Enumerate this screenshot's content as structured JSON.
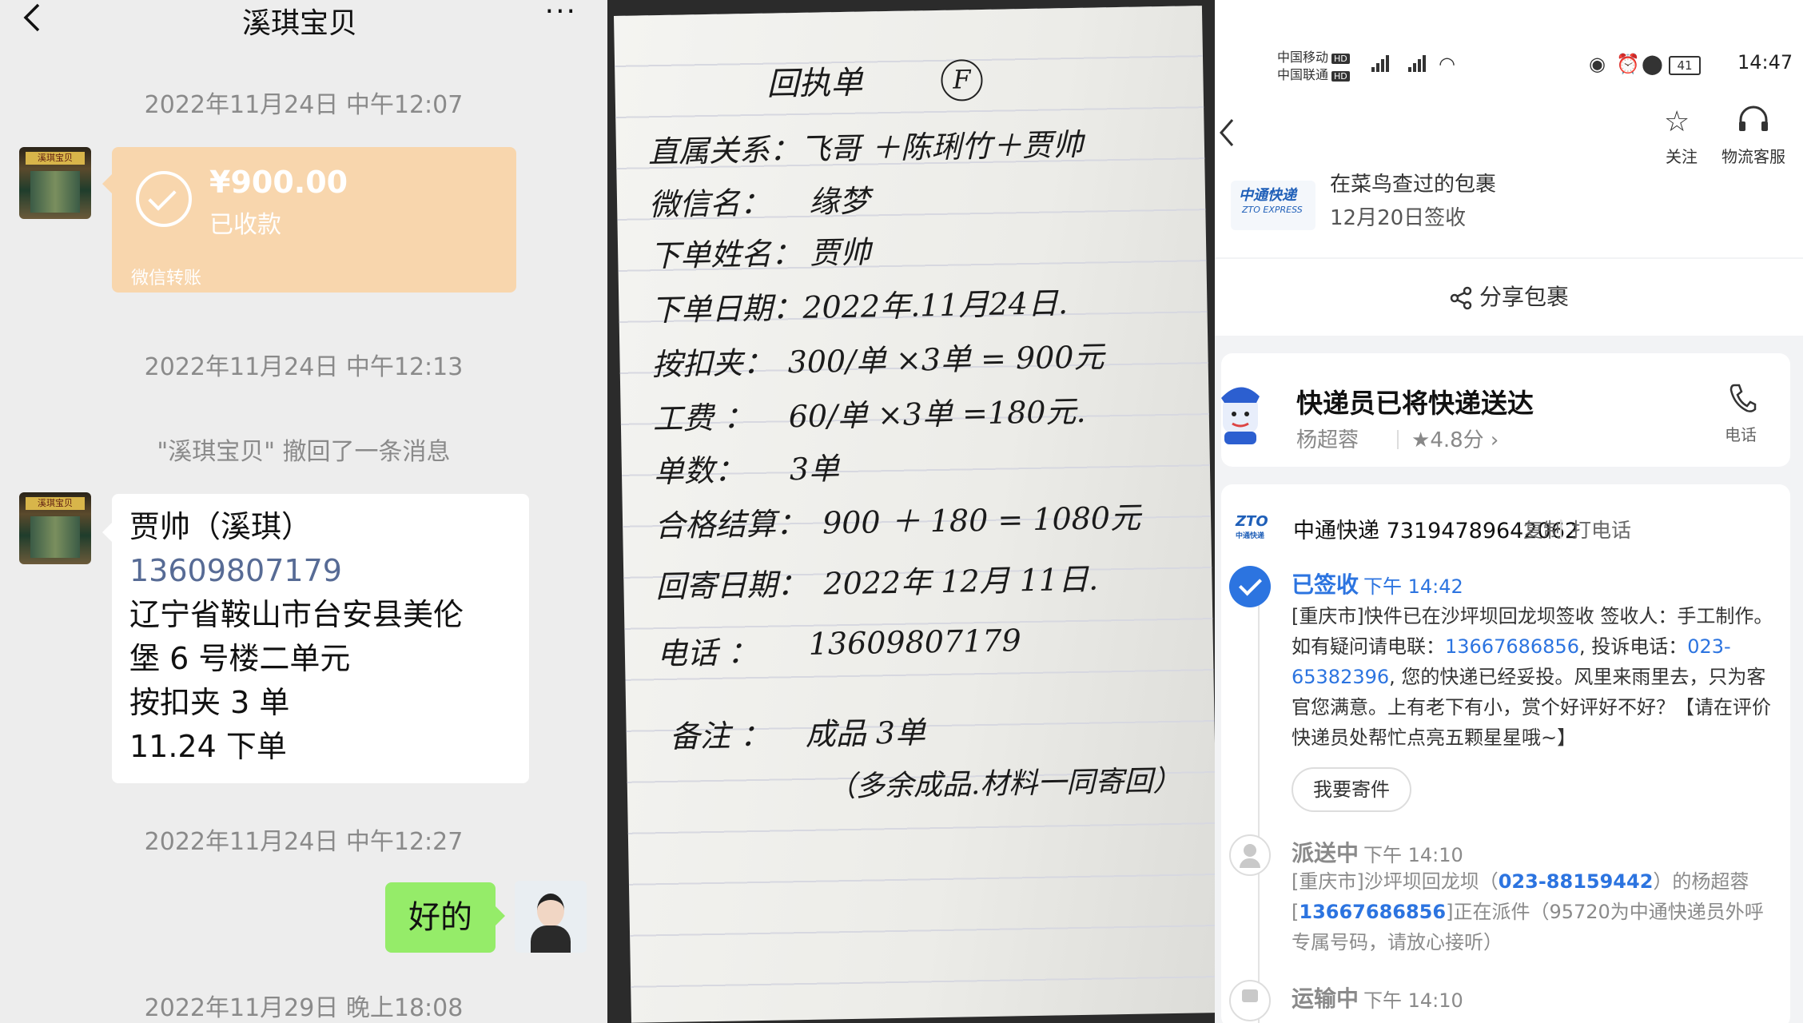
{
  "wechat": {
    "title": "溪琪宝贝",
    "more": "···",
    "ts1": "2022年11月24日 中午12:07",
    "transfer_amount": "¥900.00",
    "transfer_status": "已收款",
    "transfer_source": "微信转账",
    "ts2": "2022年11月24日 中午12:13",
    "recall": "\"溪琪宝贝\" 撤回了一条消息",
    "msg_lines": [
      "贾帅（溪琪）",
      "13609807179",
      "辽宁省鞍山市台安县美伦",
      "堡 6 号楼二单元",
      "按扣夹 3 单",
      "11.24 下单"
    ],
    "ts3": "2022年11月24日 中午12:27",
    "reply": "好的",
    "ts4": "2022年11月29日 晚上18:08"
  },
  "receipt": {
    "title": "回执单",
    "circle": "F",
    "rows": [
      {
        "k": "直属关系：",
        "v": "飞哥 ＋陈琍竹＋贾帅"
      },
      {
        "k": "微信名：",
        "v": "缘梦"
      },
      {
        "k": "下单姓名：",
        "v": "贾帅"
      },
      {
        "k": "下单日期：",
        "v": "2022年.11月24日."
      },
      {
        "k": "按扣夹：",
        "v": "300/单 ×3单 = 900元"
      },
      {
        "k": "工费 ：",
        "v": "60/单 ×3单 =180元."
      },
      {
        "k": "单数：",
        "v": "3单"
      },
      {
        "k": "合格结算：",
        "v": "900 ＋ 180 = 1080元"
      },
      {
        "k": "回寄日期：",
        "v": "2022年 12月 11日."
      },
      {
        "k": "电话 ：",
        "v": "13609807179"
      },
      {
        "k": "备注 ：",
        "v": "成品 3单"
      }
    ],
    "note2": "（多余成品.材料一同寄回）"
  },
  "zto": {
    "carrier1": "中国移动",
    "carrier2": "中国联通",
    "hd": "HD",
    "battery": "41",
    "time": "14:47",
    "follow": "关注",
    "service": "物流客服",
    "pkg_cut": "在菜鸟查过的包裹",
    "pkg_date": "12月20日签收",
    "logo_cn": "中通快递",
    "logo_en": "ZTO EXPRESS",
    "share": "分享包裹",
    "delivered": "快递员已将快递送达",
    "courier": "杨超蓉",
    "rating": "4.8分",
    "call": "电话",
    "zlogo": "ZTO",
    "zlogo_cn": "中通快递",
    "tracking": "中通快递 73194789642062",
    "copy": "复制",
    "phone_btn": "打电话",
    "ev1_title": "已签收",
    "ev1_time": "下午 14:42",
    "ev1_a": "[重庆市]快件已在沙坪坝回龙坝签收 签收人：手工制作。如有疑问请电联：",
    "ev1_phone": "13667686856",
    "ev1_b": ", 投诉电话：",
    "ev1_phone2": "023-65382396",
    "ev1_c": ", 您的快递已经妥投。风里来雨里去，只为客官您满意。上有老下有小，赏个好评好不好？【请在评价快递员处帮忙点亮五颗星星哦~】",
    "send_btn": "我要寄件",
    "ev2_title": "派送中",
    "ev2_time": "下午 14:10",
    "ev2_a": "[重庆市]沙坪坝回龙坝（",
    "ev2_phone": "023-88159442",
    "ev2_b": "）的杨超蓉",
    "ev2_c": "[",
    "ev2_phone2": "13667686856",
    "ev2_d": "]正在派件（95720为中通快递员外呼专属号码，请放心接听）",
    "ev3_title": "运输中",
    "ev3_time": "下午 14:10"
  }
}
